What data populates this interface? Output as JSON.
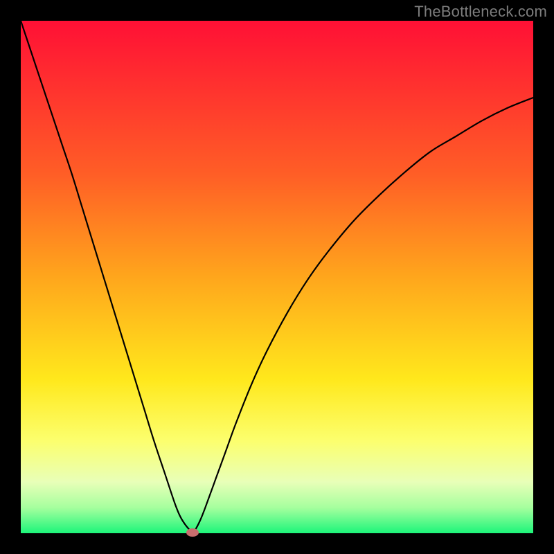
{
  "watermark": "TheBottleneck.com",
  "chart_data": {
    "type": "line",
    "title": "",
    "xlabel": "",
    "ylabel": "",
    "xlim": [
      0,
      100
    ],
    "ylim": [
      0,
      100
    ],
    "x": [
      0,
      2,
      4,
      6,
      8,
      10,
      12,
      14,
      16,
      18,
      20,
      22,
      24,
      26,
      28,
      30,
      31,
      32,
      33,
      33.5,
      34,
      35,
      36,
      38,
      40,
      42,
      45,
      48,
      52,
      56,
      60,
      65,
      70,
      75,
      80,
      85,
      90,
      95,
      100
    ],
    "values": [
      100,
      94,
      88,
      82,
      76,
      70,
      63.5,
      57,
      50.5,
      44,
      37.5,
      31,
      24.5,
      18,
      12,
      6,
      3.5,
      1.8,
      0.6,
      0.2,
      0.6,
      2.5,
      5,
      10.5,
      16,
      21.5,
      29,
      35.5,
      43,
      49.5,
      55,
      61,
      66,
      70.5,
      74.5,
      77.5,
      80.5,
      83,
      85
    ],
    "marker": {
      "x": 33.5,
      "y": 0.2
    },
    "background_gradient": {
      "stops": [
        {
          "offset": 0,
          "color": "#ff1035"
        },
        {
          "offset": 0.3,
          "color": "#ff5e26"
        },
        {
          "offset": 0.5,
          "color": "#ffa61c"
        },
        {
          "offset": 0.7,
          "color": "#ffe81c"
        },
        {
          "offset": 0.82,
          "color": "#fcff6e"
        },
        {
          "offset": 0.9,
          "color": "#e8ffb8"
        },
        {
          "offset": 0.95,
          "color": "#a6ff9e"
        },
        {
          "offset": 1.0,
          "color": "#1cf57a"
        }
      ]
    },
    "colors": {
      "curve": "#000000",
      "marker": "#c86e6e",
      "frame": "#000000"
    }
  }
}
